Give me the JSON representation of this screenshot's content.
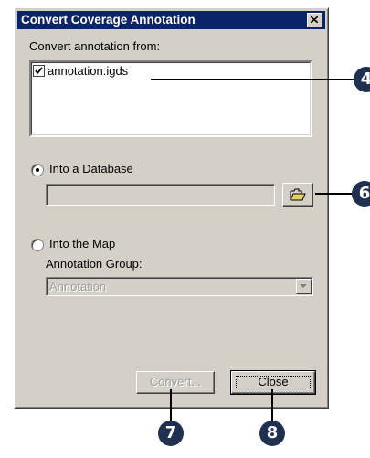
{
  "dialog": {
    "title": "Convert Coverage Annotation"
  },
  "source": {
    "label": "Convert annotation from:",
    "items": [
      {
        "label": "annotation.igds",
        "checked": true
      }
    ]
  },
  "options": {
    "database": {
      "label": "Into a Database",
      "selected": true,
      "path_value": ""
    },
    "map": {
      "label": "Into the Map",
      "selected": false
    }
  },
  "annotation_group": {
    "label": "Annotation Group:",
    "value": "Annotation"
  },
  "buttons": {
    "convert": "Convert...",
    "close": "Close"
  },
  "callouts": [
    "4",
    "6",
    "7",
    "8"
  ],
  "colors": {
    "titlebar": "#0a246a",
    "dialog_face": "#d4d0c8",
    "callout": "#1f3050"
  }
}
